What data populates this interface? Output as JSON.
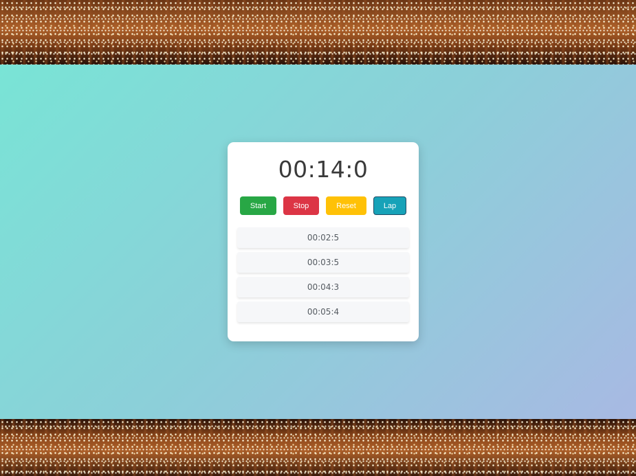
{
  "stopwatch": {
    "time": "00:14:0",
    "buttons": {
      "start": "Start",
      "stop": "Stop",
      "reset": "Reset",
      "lap": "Lap"
    },
    "laps": [
      "00:02:5",
      "00:03:5",
      "00:04:3",
      "00:05:4"
    ]
  },
  "colors": {
    "start": "#28a745",
    "stop": "#dc3545",
    "reset": "#ffc107",
    "lap": "#17a2b8",
    "gradient_start": "#79e4d6",
    "gradient_end": "#a8b9e3"
  }
}
